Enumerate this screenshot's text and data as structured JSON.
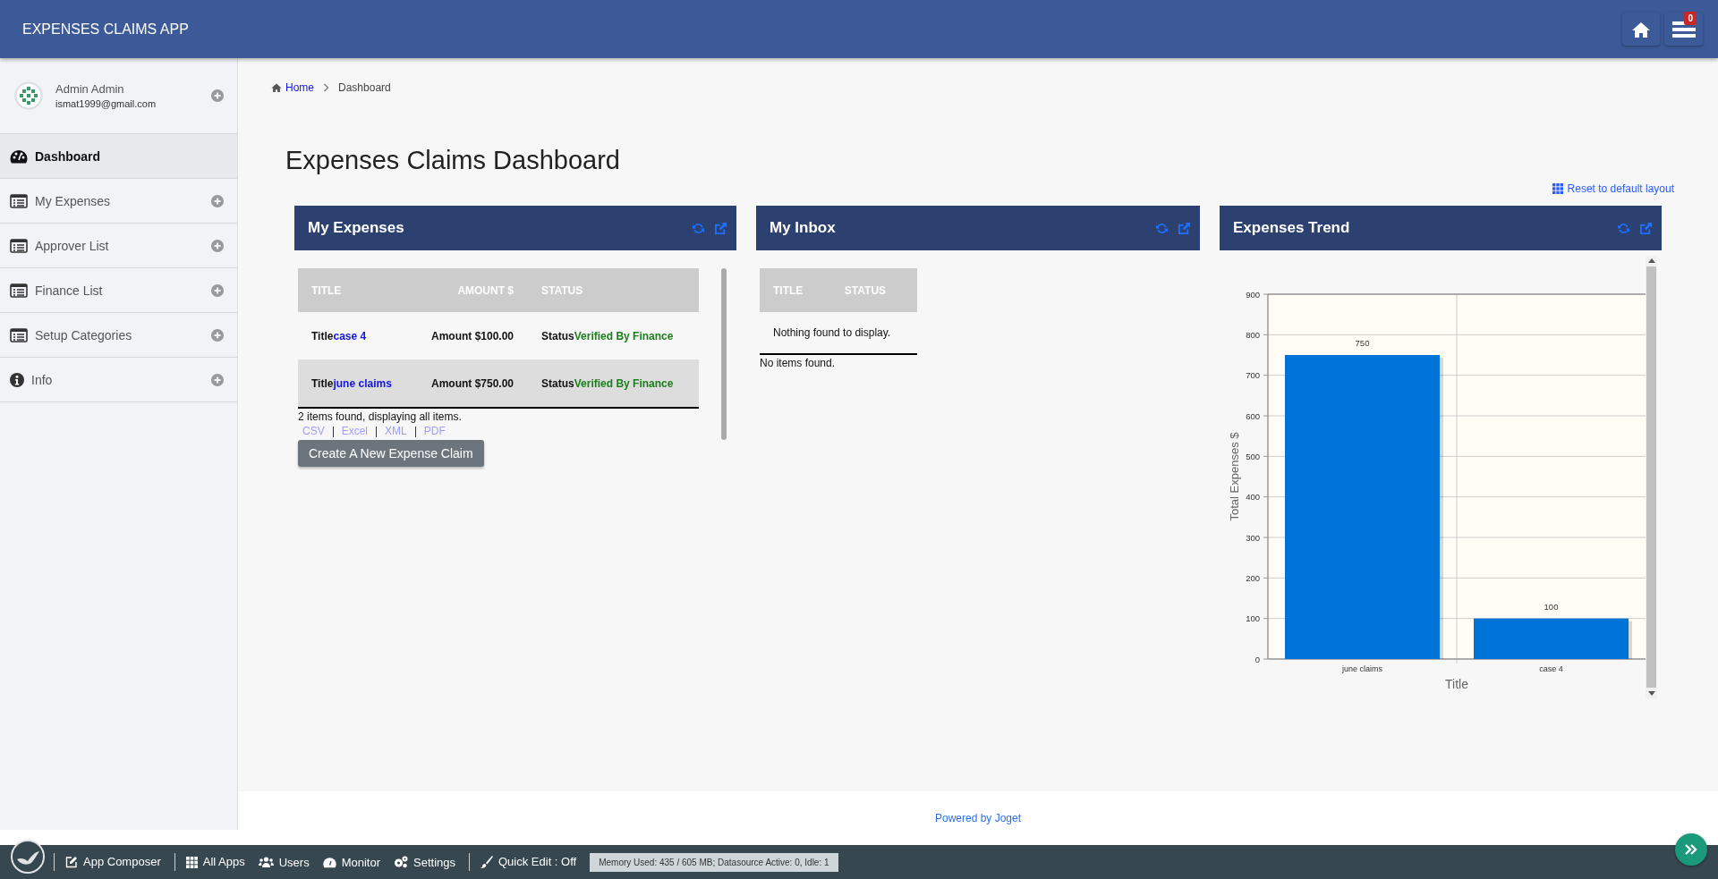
{
  "app_title": "EXPENSES CLAIMS APP",
  "notification_badge": "0",
  "user": {
    "name": "Admin Admin",
    "email": "ismat1999@gmail.com"
  },
  "sidebar": {
    "items": [
      {
        "label": "Dashboard",
        "selected": true,
        "expandable": false
      },
      {
        "label": "My Expenses",
        "selected": false,
        "expandable": true
      },
      {
        "label": "Approver List",
        "selected": false,
        "expandable": true
      },
      {
        "label": "Finance List",
        "selected": false,
        "expandable": true
      },
      {
        "label": "Setup Categories",
        "selected": false,
        "expandable": true
      },
      {
        "label": "Info",
        "selected": false,
        "expandable": true
      }
    ]
  },
  "breadcrumb": [
    "Home",
    "Dashboard"
  ],
  "page_title": "Expenses Claims Dashboard",
  "reset_link": "Reset to default layout",
  "panels": [
    {
      "kind": "table",
      "title": "My Expenses",
      "columns": [
        "TITLE",
        "AMOUNT $",
        "STATUS"
      ],
      "rows": [
        {
          "title_label": "Title",
          "title": "case 4",
          "amount": "Amount $100.00",
          "status_label": "Status",
          "status": "Verified By Finance"
        },
        {
          "title_label": "Title",
          "title": "june claims",
          "amount": "Amount $750.00",
          "status_label": "Status",
          "status": "Verified By Finance"
        }
      ],
      "summary": "2 items found, displaying all items.",
      "exports": [
        "CSV",
        "Excel",
        "XML",
        "PDF"
      ],
      "button": "Create A New Expense Claim"
    },
    {
      "kind": "table",
      "title": "My Inbox",
      "columns": [
        "TITLE",
        "STATUS"
      ],
      "empty_message": "Nothing found to display.",
      "summary": "No items found."
    },
    {
      "kind": "chart",
      "title": "Expenses Trend",
      "chart_data": {
        "type": "bar",
        "xlabel": "Title",
        "ylabel": "Total Expenses $",
        "categories": [
          "june claims",
          "case 4"
        ],
        "series": [
          {
            "color": "#0073d9",
            "values": [
              750,
              100
            ]
          }
        ],
        "ylim": [
          0,
          900
        ],
        "yticks": [
          0,
          100,
          200,
          300,
          400,
          500,
          600,
          700,
          800,
          900
        ],
        "grid": true,
        "data_labels": true
      }
    }
  ],
  "footer": "Powered by Joget",
  "admin_bar": {
    "items": [
      {
        "label": "App Composer",
        "group_start": true
      },
      {
        "label": "All Apps",
        "group_start": true
      },
      {
        "label": "Users",
        "group_start": false
      },
      {
        "label": "Monitor",
        "group_start": false
      },
      {
        "label": "Settings",
        "group_start": false
      },
      {
        "label": "Quick Edit : Off",
        "group_start": true
      }
    ],
    "memory": "Memory Used: 435 / 605 MB; Datasource Active: 0, Idle: 1"
  }
}
